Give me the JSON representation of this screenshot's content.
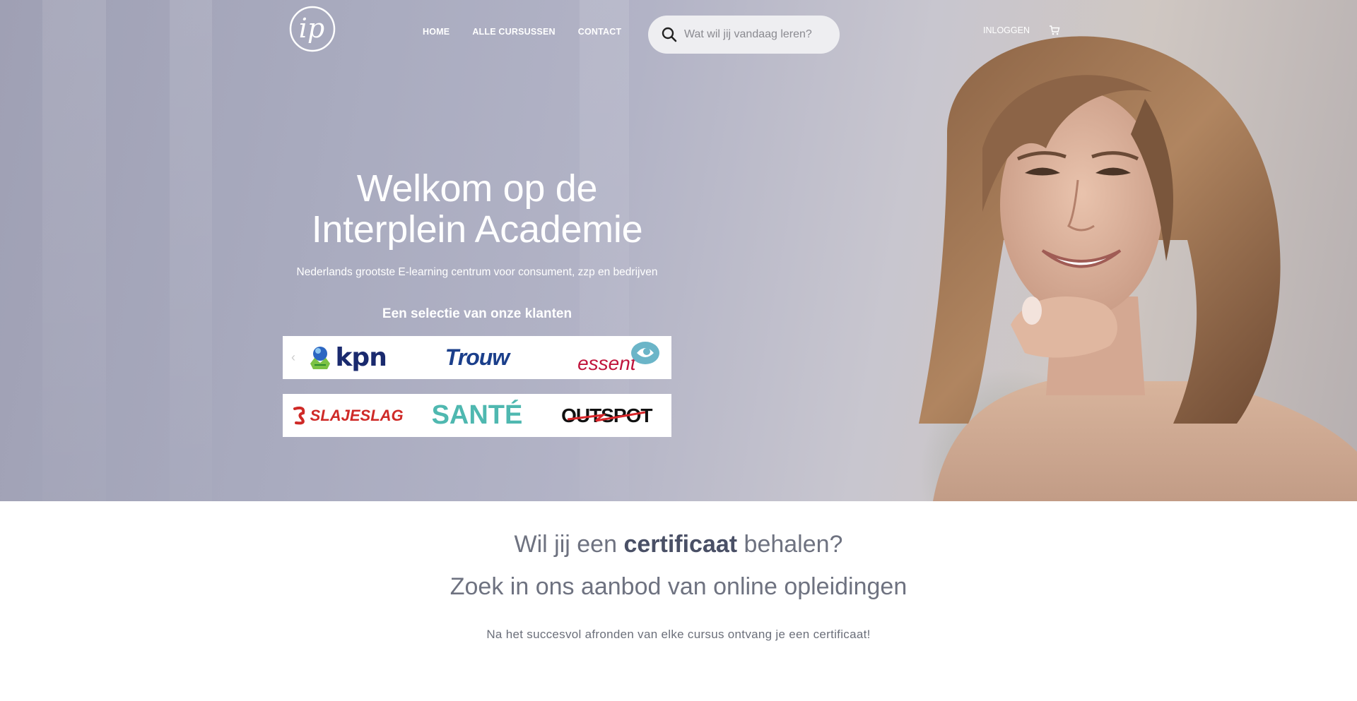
{
  "nav": {
    "items": [
      "HOME",
      "ALLE CURSUSSEN",
      "CONTACT"
    ],
    "search_placeholder": "Wat wil jij vandaag leren?",
    "login_label": "INLOGGEN"
  },
  "logo": {
    "text": "ip"
  },
  "hero": {
    "title": "Welkom op de Interplein Academie",
    "subtitle": "Nederlands grootste E-learning centrum voor consument, zzp en bedrijven",
    "clients_title": "Een selectie van onze klanten",
    "clients": {
      "kpn": "kpn",
      "trouw": "Trouw",
      "essent": "essent",
      "slajeslag": "SLAJESLAG",
      "sante": "SANTÉ",
      "outspot": "OUTSPOT"
    }
  },
  "certificate": {
    "line1_pre": "Wil jij een ",
    "line1_bold": "certificaat",
    "line1_post": " behalen?",
    "line2": "Zoek in ons aanbod van online opleidingen",
    "line3": "Na het succesvol afronden van elke cursus ontvang je een certificaat!"
  },
  "colors": {
    "accent_text": "#4a5066",
    "essent_red": "#c0143c",
    "trouw_blue": "#1b3f8b",
    "kpn_navy": "#1a2a6e",
    "sante_teal": "#4fb8b0"
  }
}
